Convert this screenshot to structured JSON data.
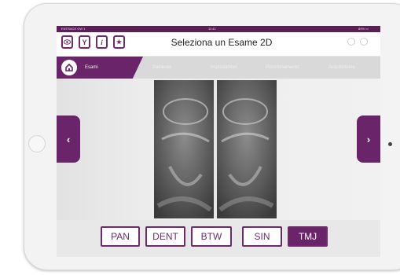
{
  "statusbar": {
    "left": "ENTRACE GW 1",
    "center": "11:41",
    "right": "89% ▭"
  },
  "toolbar": {
    "buttons": [
      {
        "icon": "eye-icon",
        "glyph": "◉"
      },
      {
        "icon": "filter-icon",
        "glyph": "Y"
      },
      {
        "icon": "info-icon",
        "glyph": "i"
      },
      {
        "icon": "star-icon",
        "glyph": "★"
      }
    ],
    "title": "Seleziona un Esame 2D"
  },
  "nav": {
    "active_label": "Esami",
    "items": [
      "Paziente",
      "Impostazioni",
      "Posizionamento",
      "Acquisizione"
    ]
  },
  "sides": {
    "prev": "‹",
    "next": "›"
  },
  "tabs": [
    {
      "label": "PAN",
      "selected": false
    },
    {
      "label": "DENT",
      "selected": false
    },
    {
      "label": "BTW",
      "selected": false
    },
    {
      "label": "SIN",
      "selected": false
    },
    {
      "label": "TMJ",
      "selected": true
    }
  ],
  "colors": {
    "brand": "#6a246a",
    "status": "#5b1f57"
  }
}
